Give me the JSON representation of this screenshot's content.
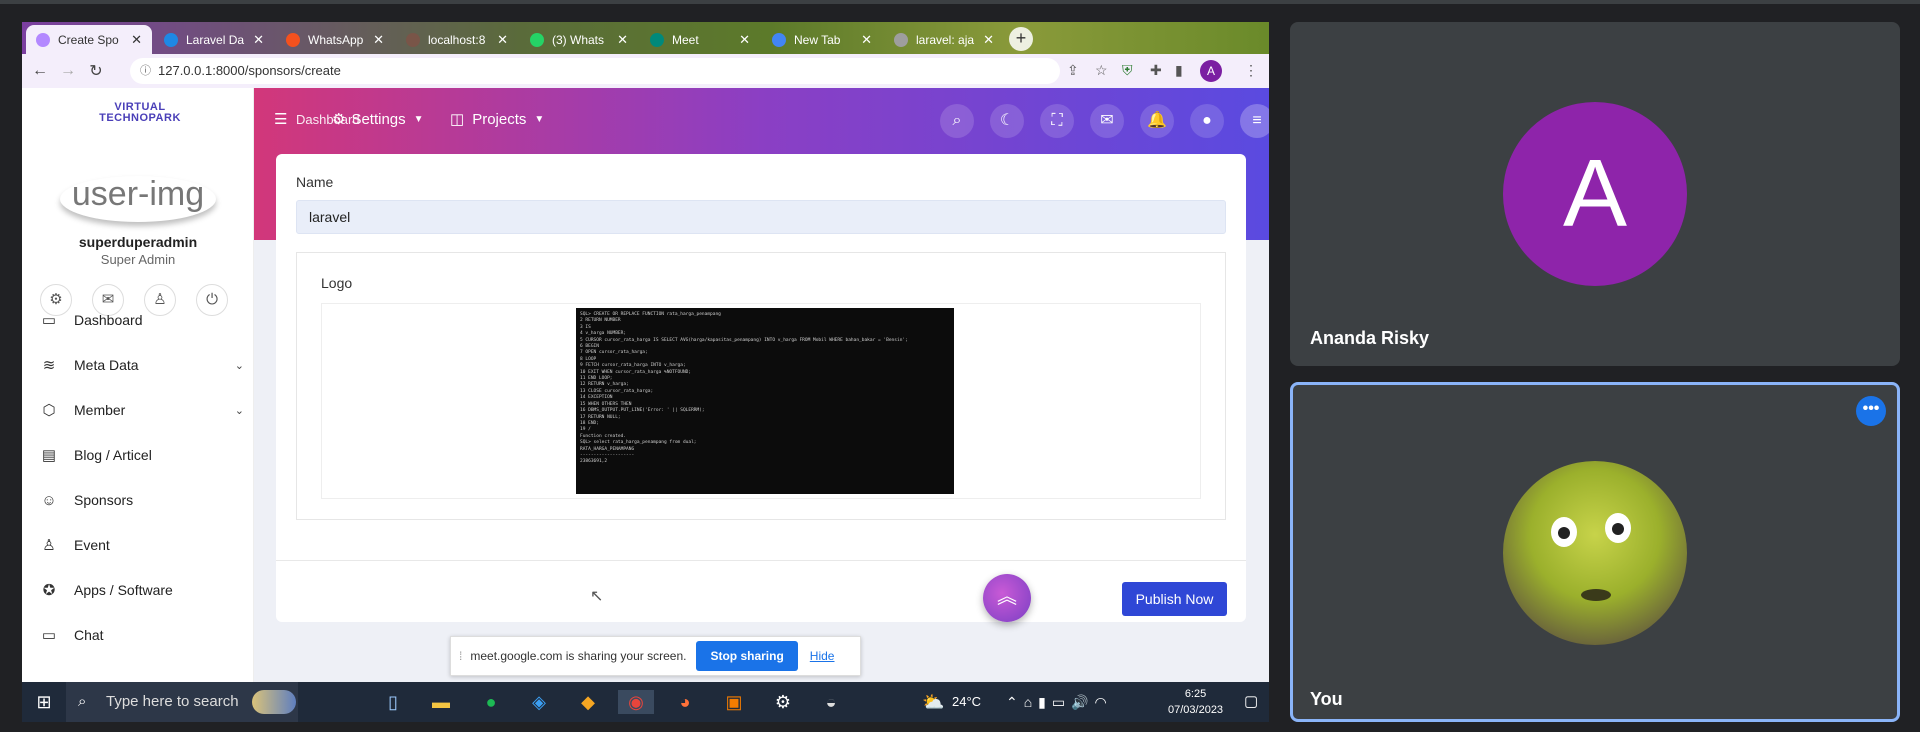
{
  "browser": {
    "tabs": [
      {
        "label": "Create Spo",
        "favcolor": "#b388ff",
        "active": true
      },
      {
        "label": "Laravel Da",
        "favcolor": "#1e88e5"
      },
      {
        "label": "WhatsApp",
        "favcolor": "#f4511e"
      },
      {
        "label": "localhost:8",
        "favcolor": "#795548"
      },
      {
        "label": "(3) Whats",
        "favcolor": "#25d366"
      },
      {
        "label": "Meet",
        "favcolor": "#00897b"
      },
      {
        "label": "New Tab",
        "favcolor": "#4285f4"
      },
      {
        "label": "laravel: aja",
        "favcolor": "#9e9e9e"
      }
    ],
    "url": "127.0.0.1:8000/sponsors/create",
    "profile_initial": "A"
  },
  "app": {
    "logo": "VIRTUAL TECHNOPARK",
    "avatar_alt": "user-img",
    "username": "superduperadmin",
    "role": "Super Admin",
    "header": {
      "dashboard": "Dashboard",
      "settings": "Settings",
      "projects": "Projects"
    },
    "menu": [
      {
        "label": "Dashboard",
        "icon": "monitor-icon",
        "glyph": "▭"
      },
      {
        "label": "Meta Data",
        "icon": "layers-icon",
        "glyph": "≋",
        "chevron": true
      },
      {
        "label": "Member",
        "icon": "cube-icon",
        "glyph": "⬡",
        "chevron": true
      },
      {
        "label": "Blog / Articel",
        "icon": "newspaper-icon",
        "glyph": "▤"
      },
      {
        "label": "Sponsors",
        "icon": "user-icon",
        "glyph": "☺"
      },
      {
        "label": "Event",
        "icon": "person-icon",
        "glyph": "♙"
      },
      {
        "label": "Apps / Software",
        "icon": "android-icon",
        "glyph": "✪"
      },
      {
        "label": "Chat",
        "icon": "chat-icon",
        "glyph": "▭"
      }
    ],
    "form": {
      "name_label": "Name",
      "name_value": "laravel",
      "logo_label": "Logo",
      "publish_button": "Publish Now"
    },
    "logo_preview_lines": [
      "SQL> CREATE OR REPLACE FUNCTION rata_harga_penampang",
      "  2  RETURN NUMBER",
      "  3  IS",
      "  4  v_harga NUMBER;",
      "  5  CURSOR cursor_rata_harga IS SELECT AVG(harga/kapasitas_penampang) INTO v_harga FROM Mobil WHERE bahan_bakar = 'Bensin';",
      "  6  BEGIN",
      "  7  OPEN cursor_rata_harga;",
      "  8  LOOP",
      "  9  FETCH cursor_rata_harga INTO v_harga;",
      " 10  EXIT WHEN cursor_rata_harga %NOTFOUND;",
      " 11  END LOOP;",
      " 12  RETURN v_harga;",
      " 13  CLOSE cursor_rata_harga;",
      " 14  EXCEPTION",
      " 15  WHEN OTHERS THEN",
      " 16  DBMS_OUTPUT.PUT_LINE('Error: ' || SQLERRM);",
      " 17  RETURN NULL;",
      " 18  END;",
      " 19  /",
      "",
      "Function created.",
      "",
      "SQL> select rata_harga_penampang from dual;",
      "",
      "RATA_HARGA_PENAMPANG",
      "--------------------",
      "          23863691,2"
    ]
  },
  "sharing": {
    "message": "meet.google.com is sharing your screen.",
    "stop": "Stop sharing",
    "hide": "Hide"
  },
  "taskbar": {
    "search_placeholder": "Type here to search",
    "temperature": "24°C",
    "time": "6:25",
    "date": "07/03/2023"
  },
  "participants": [
    {
      "name": "Ananda Risky",
      "initial": "A",
      "color": "#8e24aa"
    },
    {
      "name": "You"
    }
  ]
}
